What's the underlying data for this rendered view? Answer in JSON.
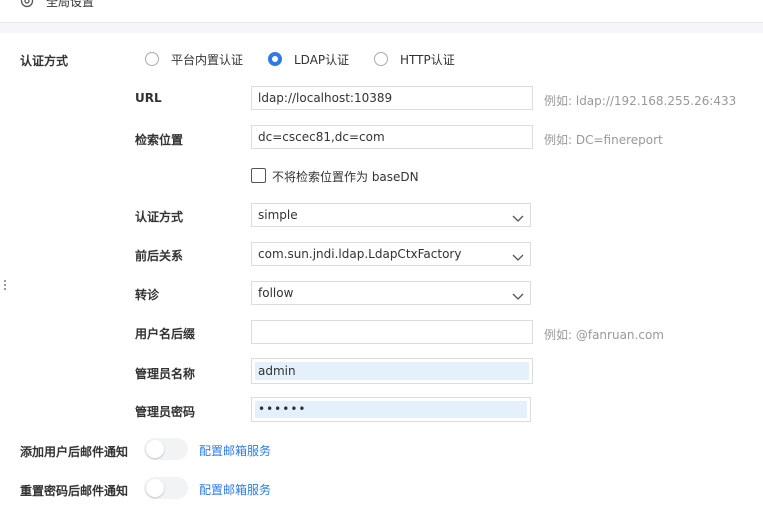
{
  "header": {
    "title": "全局设置",
    "icon": "gear-icon"
  },
  "auth": {
    "label": "认证方式",
    "options": [
      "平台内置认证",
      "LDAP认证",
      "HTTP认证"
    ],
    "selected_index": 1
  },
  "ldap": {
    "url": {
      "label": "URL",
      "value": "ldap://localhost:10389",
      "hint": "例如: ldap://192.168.255.26:433"
    },
    "search_base": {
      "label": "检索位置",
      "value": "dc=cscec81,dc=com",
      "hint": "例如: DC=finereport"
    },
    "not_as_basedn": {
      "label": "不将检索位置作为 baseDN",
      "checked": false
    },
    "auth_method": {
      "label": "认证方式",
      "value": "simple"
    },
    "context": {
      "label": "前后关系",
      "value": "com.sun.jndi.ldap.LdapCtxFactory"
    },
    "referral": {
      "label": "转诊",
      "value": "follow"
    },
    "username_suffix": {
      "label": "用户名后缀",
      "value": "",
      "hint": "例如: @fanruan.com"
    },
    "admin_name": {
      "label": "管理员名称",
      "value": "admin"
    },
    "admin_password": {
      "label": "管理员密码",
      "value": "••••••"
    }
  },
  "notify_add_user": {
    "label": "添加用户后邮件通知",
    "enabled": false,
    "link": "配置邮箱服务"
  },
  "notify_reset_pwd": {
    "label": "重置密码后邮件通知",
    "enabled": false,
    "link": "配置邮箱服务"
  },
  "colors": {
    "accent": "#2f7be6",
    "autofill": "#e4f0fb",
    "hint": "#999999"
  }
}
